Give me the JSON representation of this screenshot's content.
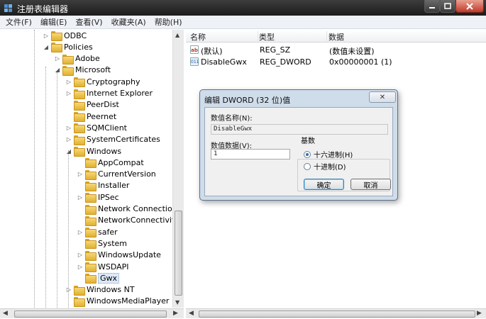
{
  "window": {
    "title": "注册表编辑器"
  },
  "menu": [
    "文件(F)",
    "编辑(E)",
    "查看(V)",
    "收藏夹(A)",
    "帮助(H)"
  ],
  "tree": [
    {
      "label": "ODBC",
      "indent": 0,
      "exp": "▷"
    },
    {
      "label": "Policies",
      "indent": 0,
      "exp": "◢"
    },
    {
      "label": "Adobe",
      "indent": 1,
      "exp": "▷"
    },
    {
      "label": "Microsoft",
      "indent": 1,
      "exp": "◢"
    },
    {
      "label": "Cryptography",
      "indent": 2,
      "exp": "▷"
    },
    {
      "label": "Internet Explorer",
      "indent": 2,
      "exp": "▷"
    },
    {
      "label": "PeerDist",
      "indent": 2,
      "exp": ""
    },
    {
      "label": "Peernet",
      "indent": 2,
      "exp": ""
    },
    {
      "label": "SQMClient",
      "indent": 2,
      "exp": "▷"
    },
    {
      "label": "SystemCertificates",
      "indent": 2,
      "exp": "▷"
    },
    {
      "label": "Windows",
      "indent": 2,
      "exp": "◢"
    },
    {
      "label": "AppCompat",
      "indent": 3,
      "exp": ""
    },
    {
      "label": "CurrentVersion",
      "indent": 3,
      "exp": "▷"
    },
    {
      "label": "Installer",
      "indent": 3,
      "exp": ""
    },
    {
      "label": "IPSec",
      "indent": 3,
      "exp": "▷"
    },
    {
      "label": "Network Connections",
      "indent": 3,
      "exp": ""
    },
    {
      "label": "NetworkConnectivitySta",
      "indent": 3,
      "exp": ""
    },
    {
      "label": "safer",
      "indent": 3,
      "exp": "▷"
    },
    {
      "label": "System",
      "indent": 3,
      "exp": ""
    },
    {
      "label": "WindowsUpdate",
      "indent": 3,
      "exp": "▷"
    },
    {
      "label": "WSDAPI",
      "indent": 3,
      "exp": "▷"
    },
    {
      "label": "Gwx",
      "indent": 3,
      "exp": "",
      "selected": true
    },
    {
      "label": "Windows NT",
      "indent": 2,
      "exp": "▷"
    },
    {
      "label": "WindowsMediaPlayer",
      "indent": 2,
      "exp": ""
    }
  ],
  "list": {
    "headers": {
      "name": "名称",
      "type": "类型",
      "data": "数据"
    },
    "rows": [
      {
        "icon": "ab",
        "icon_kind": "string-value-icon",
        "name": "(默认)",
        "type": "REG_SZ",
        "data": "(数值未设置)"
      },
      {
        "icon": "011",
        "icon_kind": "dword-value-icon",
        "name": "DisableGwx",
        "type": "REG_DWORD",
        "data": "0x00000001 (1)"
      }
    ]
  },
  "dialog": {
    "title": "编辑 DWORD (32 位)值",
    "close": "✕",
    "value_name_label": "数值名称(N):",
    "value_name": "DisableGwx",
    "value_data_label": "数值数据(V):",
    "value_data": "1",
    "base_label": "基数",
    "hex_label": "十六进制(H)",
    "dec_label": "十进制(D)",
    "base_selected": "hex",
    "ok_label": "确定",
    "cancel_label": "取消"
  }
}
